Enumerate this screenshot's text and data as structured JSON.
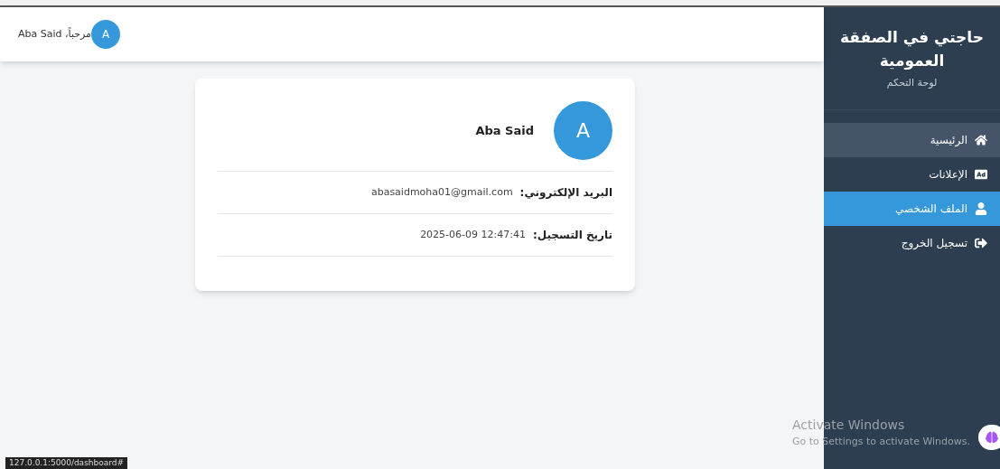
{
  "header": {
    "greeting": "مرحباً، Aba Said",
    "avatar_letter": "A"
  },
  "profile": {
    "avatar_letter": "A",
    "name": "Aba Said",
    "fields": [
      {
        "label": "البريد الإلكتروني:",
        "value": "abasaidmoha01@gmail.com"
      },
      {
        "label": "تاريخ التسجيل:",
        "value": "2025-06-09 12:47:41"
      }
    ]
  },
  "sidebar": {
    "title": "حاجتي في الصفقة العمومية",
    "subtitle": "لوحة التحكم",
    "items": [
      {
        "label": "الرئيسية",
        "kind": "home",
        "selected": false,
        "hovered": true
      },
      {
        "label": "الإعلانات",
        "kind": "ad",
        "selected": false,
        "hovered": false
      },
      {
        "label": "الملف الشخصي",
        "kind": "user",
        "selected": true,
        "hovered": false
      },
      {
        "label": "تسجيل الخروج",
        "kind": "logout",
        "selected": false,
        "hovered": false
      }
    ]
  },
  "os_notice": {
    "title": "Activate Windows",
    "text": "Go to Settings to activate Windows."
  },
  "status_url": "127.0.0.1:5000/dashboard#"
}
